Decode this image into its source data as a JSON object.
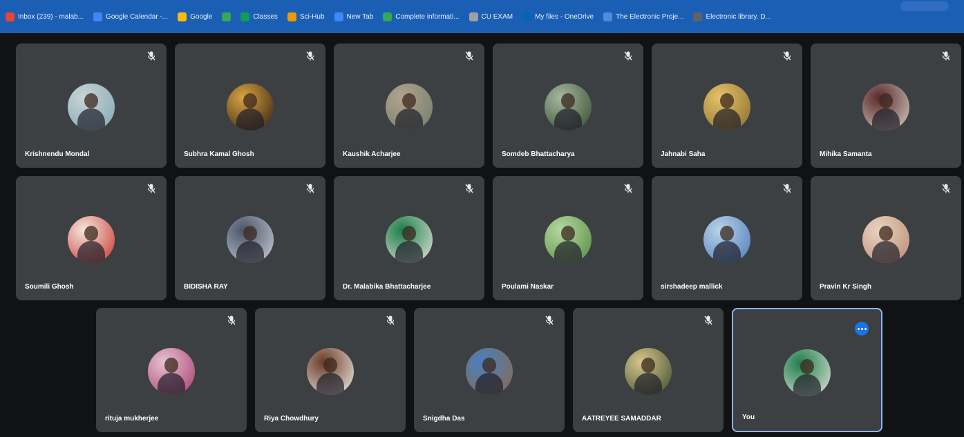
{
  "bookmarks": [
    {
      "label": "Inbox (239) - malab...",
      "icon": "gmail-icon",
      "color": "#ea4335"
    },
    {
      "label": "Google Calendar -...",
      "icon": "calendar-icon",
      "color": "#4285f4"
    },
    {
      "label": "Google",
      "icon": "google-icon",
      "color": "#fbbc04"
    },
    {
      "label": "",
      "icon": "chrome-icon",
      "color": "#34a853"
    },
    {
      "label": "Classes",
      "icon": "classroom-icon",
      "color": "#0f9d58"
    },
    {
      "label": "Sci-Hub",
      "icon": "scihub-icon",
      "color": "#f29900"
    },
    {
      "label": "New Tab",
      "icon": "chrome-icon",
      "color": "#4285f4"
    },
    {
      "label": "Complete informati...",
      "icon": "g-icon",
      "color": "#34a853"
    },
    {
      "label": "CU EXAM",
      "icon": "globe-icon",
      "color": "#9aa0a6"
    },
    {
      "label": "My files - OneDrive",
      "icon": "onedrive-icon",
      "color": "#0364b8"
    },
    {
      "label": "The Electronic Proje...",
      "icon": "document-icon",
      "color": "#4a8de0"
    },
    {
      "label": "Electronic library. D...",
      "icon": "library-icon",
      "color": "#5f6368"
    }
  ],
  "participants": [
    {
      "name": "Krishnendu Mondal",
      "avatar_colors": [
        "#7fa7b0",
        "#c8d4d6"
      ]
    },
    {
      "name": "Subhra Kamal Ghosh",
      "avatar_colors": [
        "#2e1a10",
        "#d9a441"
      ]
    },
    {
      "name": "Kaushik Acharjee",
      "avatar_colors": [
        "#6e7b6a",
        "#b3a48e"
      ]
    },
    {
      "name": "Somdeb Bhattacharya",
      "avatar_colors": [
        "#2f4a2c",
        "#a6b8a0"
      ]
    },
    {
      "name": "Jahnabi Saha",
      "avatar_colors": [
        "#8a6a2b",
        "#e3c36a"
      ]
    },
    {
      "name": "Mihika Samanta",
      "avatar_colors": [
        "#d9d0c7",
        "#5a2a2a"
      ]
    },
    {
      "name": "Soumili Ghosh",
      "avatar_colors": [
        "#c9302c",
        "#f2e7dd"
      ]
    },
    {
      "name": "BIDISHA RAY",
      "avatar_colors": [
        "#c9cfd6",
        "#4a5668"
      ]
    },
    {
      "name": "Dr. Malabika Bhattacharjee",
      "avatar_colors": [
        "#e6e6e0",
        "#1e7e4a"
      ]
    },
    {
      "name": "Poulami Naskar",
      "avatar_colors": [
        "#4f8a3e",
        "#b8d8a2"
      ]
    },
    {
      "name": "sirshadeep mallick",
      "avatar_colors": [
        "#4b79b8",
        "#b9d2e8"
      ]
    },
    {
      "name": "Pravin Kr Singh",
      "avatar_colors": [
        "#b98a6f",
        "#e9d3c1"
      ]
    },
    {
      "name": "rituja mukherjee",
      "avatar_colors": [
        "#a53a6a",
        "#e6c2d2"
      ]
    },
    {
      "name": "Riya Chowdhury",
      "avatar_colors": [
        "#f3efe8",
        "#6b3b2a"
      ]
    },
    {
      "name": "Snigdha Das",
      "avatar_colors": [
        "#8a6a4a",
        "#4a7fc1"
      ]
    },
    {
      "name": "AATREYEE SAMADDAR",
      "avatar_colors": [
        "#3a4a2a",
        "#d8c68e"
      ]
    },
    {
      "name": "You",
      "avatar_colors": [
        "#e6e6e0",
        "#1e7e4a"
      ],
      "self": true
    }
  ]
}
